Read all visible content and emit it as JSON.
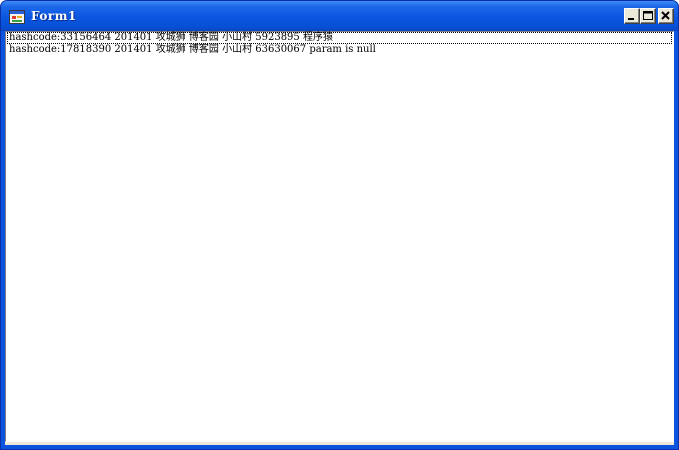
{
  "window": {
    "title": "Form1"
  },
  "icons": {
    "app": "form-app-icon",
    "minimize": "minimize-icon",
    "maximize": "maximize-icon",
    "close": "close-icon"
  },
  "colors": {
    "titlebar": "#0a56e0",
    "client": "#ece9d8",
    "listbox_bg": "#ffffff"
  },
  "listbox": {
    "items": [
      "hashcode:33156464 201401 攻城狮 博客园 小山村 5923895 程序猿",
      "hashcode:17818390 201401 攻城狮 博客园 小山村 63630067 param is null"
    ]
  }
}
